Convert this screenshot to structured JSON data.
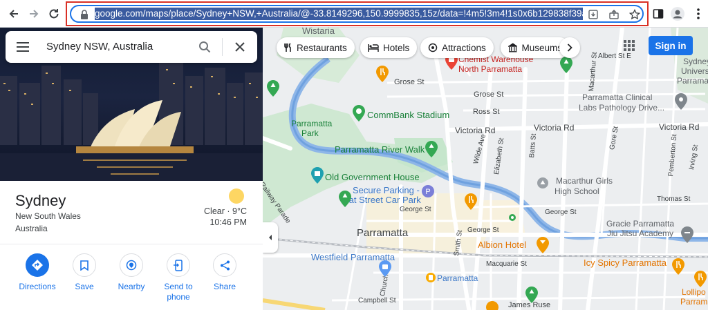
{
  "browser": {
    "url": "google.com/maps/place/Sydney+NSW,+Australia/@-33.8149296,150.9999835,15z/data=!4m5!3m4!1s0x6b129838f39a743f"
  },
  "search": {
    "value": "Sydney NSW, Australia"
  },
  "place": {
    "title": "Sydney",
    "subtitle_line1": "New South Wales",
    "subtitle_line2": "Australia",
    "weather": "Clear · 9°C",
    "time": "10:46 PM"
  },
  "actions": [
    {
      "label": "Directions"
    },
    {
      "label": "Save"
    },
    {
      "label": "Nearby"
    },
    {
      "label": "Send to phone"
    },
    {
      "label": "Share"
    }
  ],
  "chips": [
    {
      "label": "Restaurants"
    },
    {
      "label": "Hotels"
    },
    {
      "label": "Attractions"
    },
    {
      "label": "Museums"
    }
  ],
  "header": {
    "sign_in": "Sign in"
  },
  "map": {
    "labels": {
      "wistaria": "Wistaria",
      "chemist": "Chemist Warehouse",
      "north_parra": "North Parramatta",
      "grose_st_1": "Grose St",
      "grose_st_2": "Grose St",
      "ross_st": "Ross St",
      "commbank": "CommBank Stadium",
      "parramatta_park_1": "Parramatta",
      "parramatta_park_2": "Park",
      "victoria_rd_1": "Victoria Rd",
      "victoria_rd_2": "Victoria Rd",
      "victoria_rd_3": "Victoria Rd",
      "river_walk": "Parramatta River Walk",
      "old_gov": "Old Government House",
      "secure_1": "Secure Parking -",
      "secure_2": "Eat Street Car Park",
      "parramatta": "Parramatta",
      "westfield": "Westfield Parramatta",
      "parramatta_station": "Parramatta",
      "albion": "Albion Hotel",
      "macarthur_1": "Macarthur Girls",
      "macarthur_2": "High School",
      "gracie_1": "Gracie Parramatta",
      "gracie_2": "Jiu Jitsu Academy",
      "icy_spicy": "Icy Spicy Parramatta",
      "clinical_1": "Parramatta Clinical",
      "clinical_2": "Labs Pathology Drive...",
      "sydney_uni_1": "Sydney",
      "sydney_uni_2": "Univers",
      "sydney_uni_3": "Parramatta",
      "lollipo_1": "Lollipo",
      "lollipo_2": "Parrama",
      "railway_parade": "Railway Parade",
      "george_st_1": "George St",
      "george_st_2": "George St",
      "george_st_3": "George St",
      "macquarie_st": "Macquarie St",
      "campbell_st": "Campbell St",
      "wilde_ave": "Wilde Ave",
      "elizabeth_st": "Elizabeth St",
      "batts_st": "Batts St",
      "gore_st": "Gore St",
      "pemberton_st": "Pemberton St",
      "irving_st": "Irving St",
      "thomas_st": "Thomas St",
      "albert_st": "Albert St E",
      "macarthur_st": "Macarthur St",
      "smith_st": "Smith St",
      "church_st": "Church St",
      "james_ruse": "James Ruse"
    }
  }
}
